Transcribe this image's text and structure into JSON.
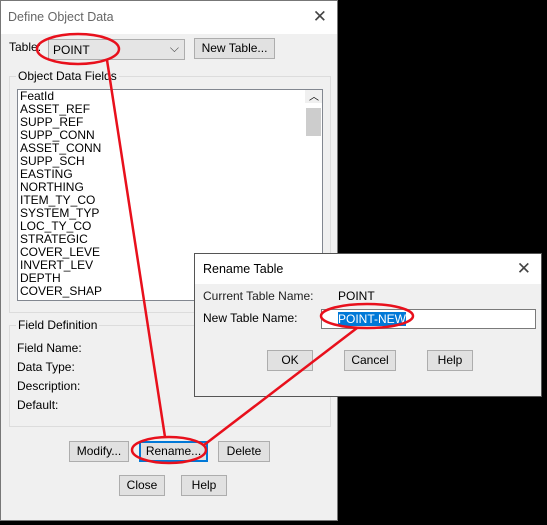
{
  "main": {
    "title": "Define Object Data",
    "table_label": "Table:",
    "table_value": "POINT",
    "new_table": "New Table...",
    "fields_group": "Object Data Fields",
    "fields": [
      "FeatId",
      "ASSET_REF",
      "SUPP_REF",
      "SUPP_CONN",
      "ASSET_CONN",
      "SUPP_SCH",
      "EASTING",
      "NORTHING",
      "ITEM_TY_CO",
      "SYSTEM_TYP",
      "LOC_TY_CO",
      "STRATEGIC",
      "COVER_LEVE",
      "INVERT_LEV",
      "DEPTH",
      "COVER_SHAP"
    ],
    "def_group": "Field Definition",
    "field_name": "Field Name:",
    "data_type": "Data Type:",
    "description": "Description:",
    "default": "Default:",
    "modify": "Modify...",
    "rename": "Rename...",
    "delete": "Delete",
    "close": "Close",
    "help": "Help"
  },
  "rename": {
    "title": "Rename Table",
    "current_label": "Current Table Name:",
    "current_value": "POINT",
    "new_label": "New Table Name:",
    "new_value": "POINT-NEW",
    "ok": "OK",
    "cancel": "Cancel",
    "help": "Help"
  },
  "colors": {
    "annotation": "#e8101c",
    "selection": "#0078d7"
  }
}
